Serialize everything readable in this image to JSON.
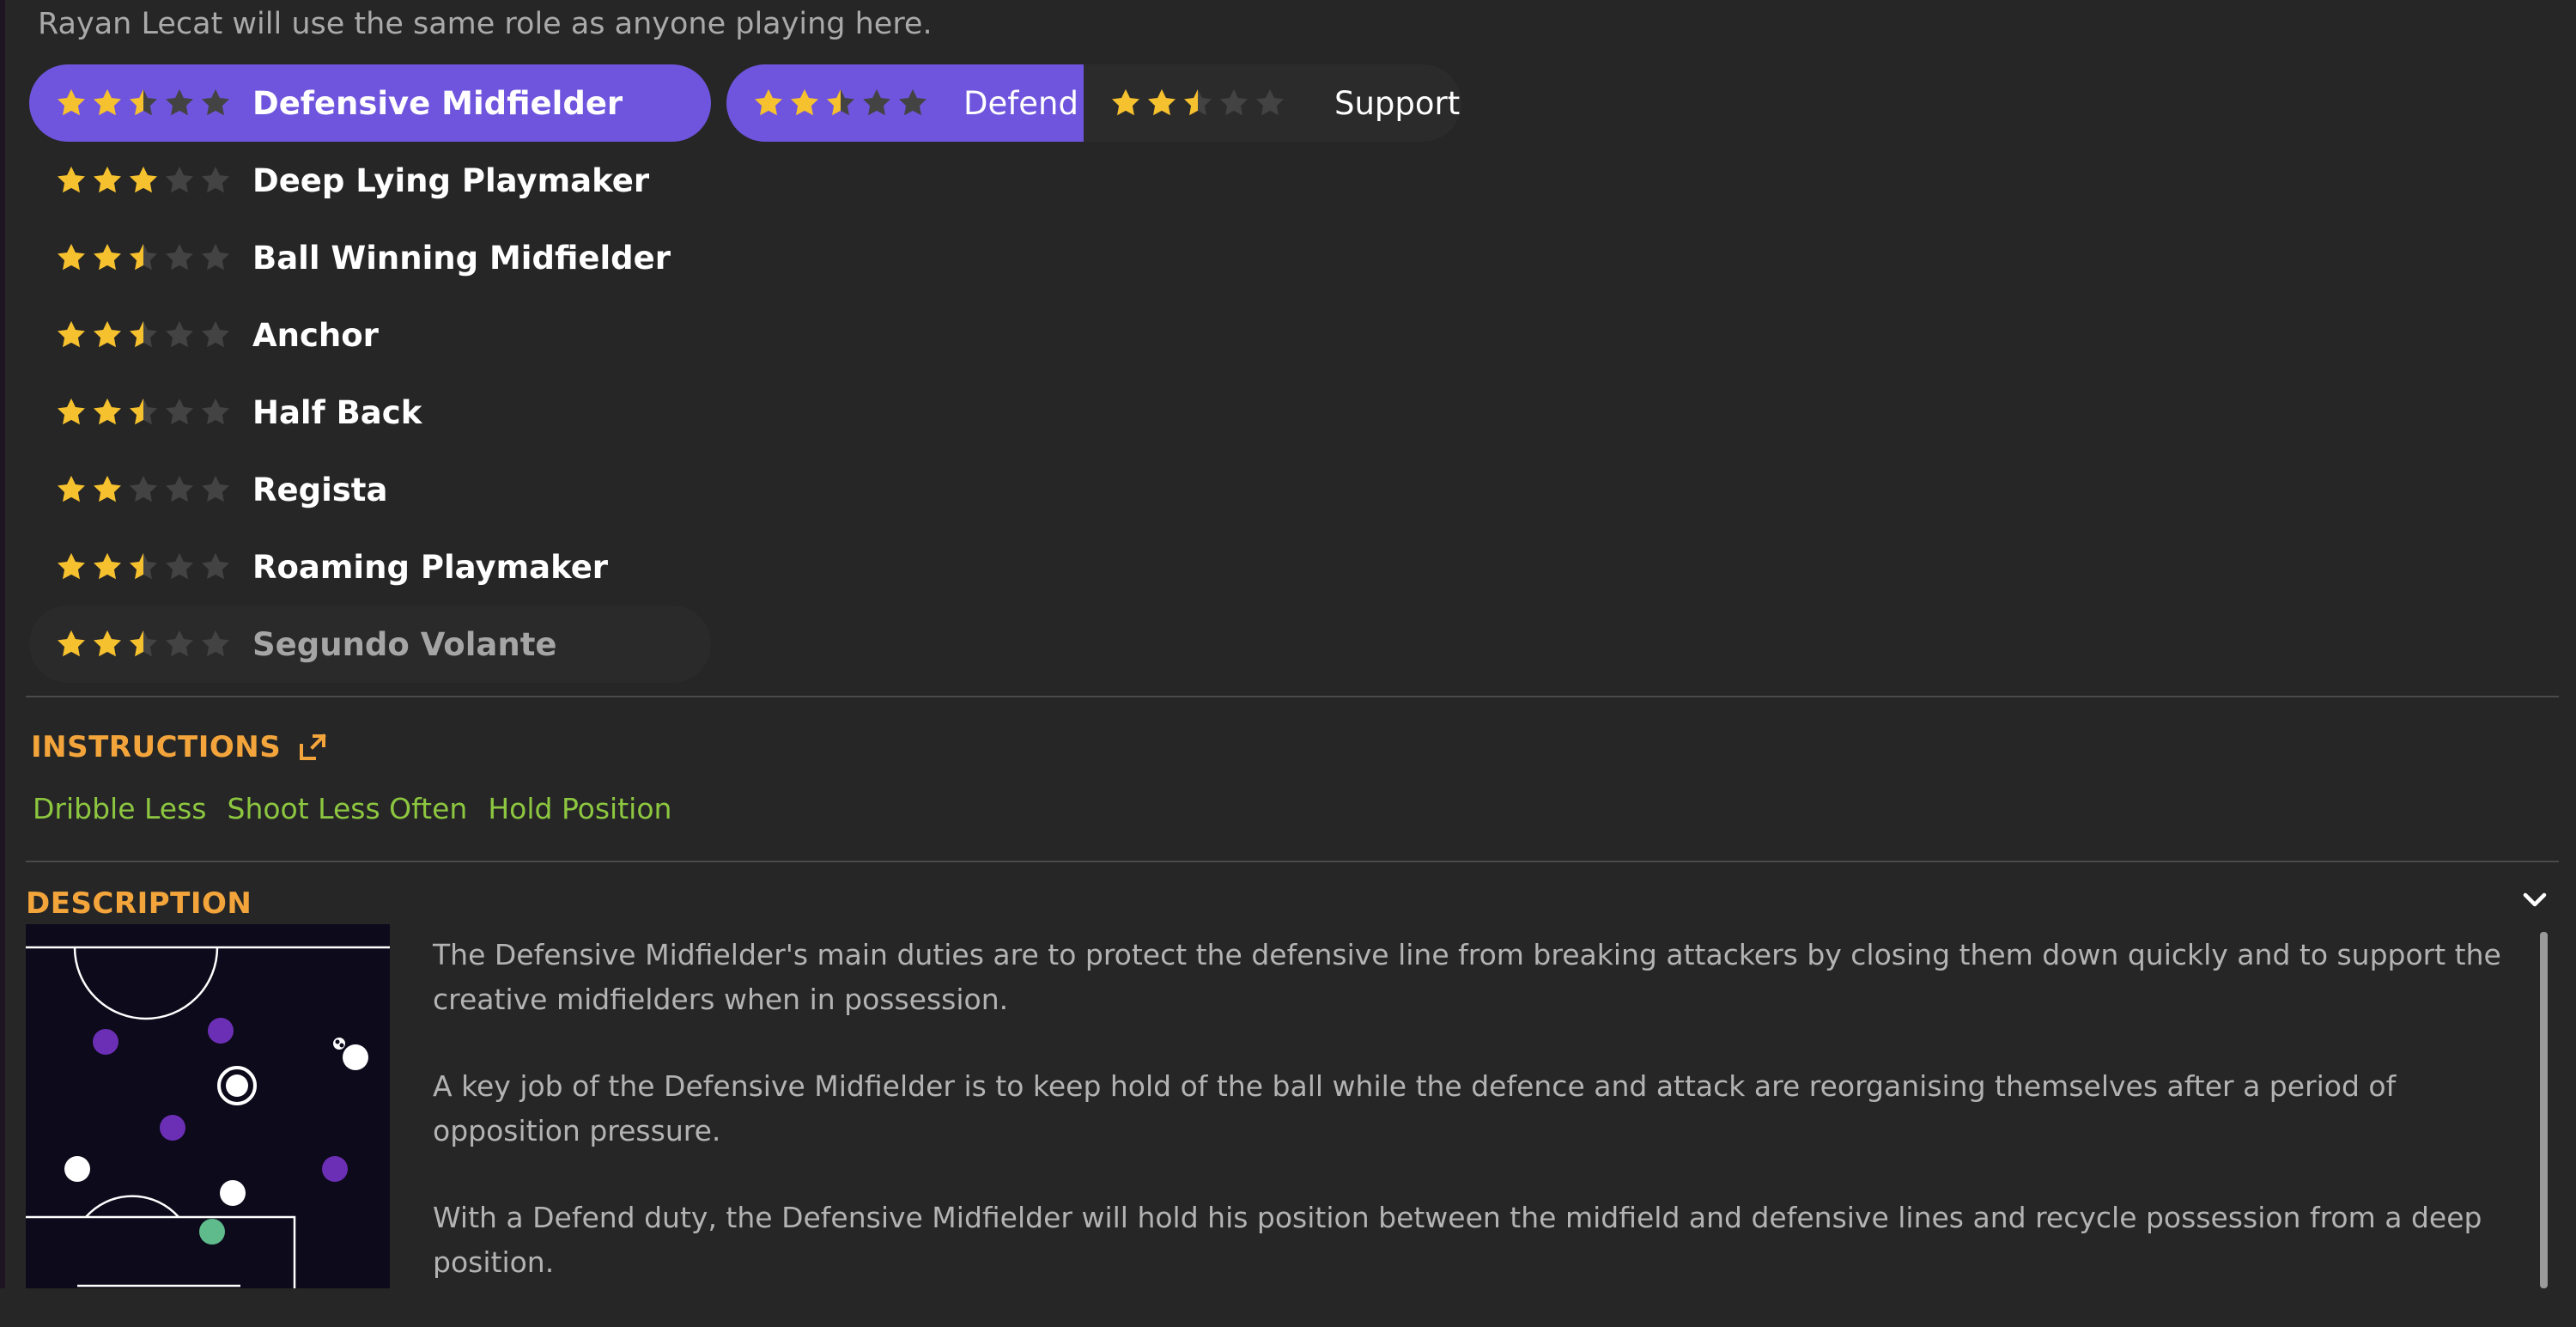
{
  "intro_text": "Rayan Lecat will use the same role as anyone playing here.",
  "colors": {
    "accent": "#6f55dd",
    "star_filled": "#f6c12e",
    "star_empty": "#434343",
    "section_title": "#f3a53b",
    "instruction": "#8dc740",
    "background": "#262626"
  },
  "roles": [
    {
      "name": "Defensive Midfielder",
      "stars": 2.5,
      "selected": true
    },
    {
      "name": "Deep Lying Playmaker",
      "stars": 3
    },
    {
      "name": "Ball Winning Midfielder",
      "stars": 2.5
    },
    {
      "name": "Anchor",
      "stars": 2.5
    },
    {
      "name": "Half Back",
      "stars": 2.5
    },
    {
      "name": "Regista",
      "stars": 2
    },
    {
      "name": "Roaming Playmaker",
      "stars": 2.5
    },
    {
      "name": "Segundo Volante",
      "stars": 2.5,
      "dimmed": true
    }
  ],
  "duties": [
    {
      "label": "Defend",
      "stars": 2.5,
      "selected": true
    },
    {
      "label": "Support",
      "stars": 2.5
    }
  ],
  "instructions": {
    "title": "INSTRUCTIONS",
    "icon": "expand-icon",
    "items": [
      "Dribble Less",
      "Shoot Less Often",
      "Hold Position"
    ]
  },
  "description": {
    "title": "DESCRIPTION",
    "icon": "chevron-down-icon",
    "paragraphs": [
      "The Defensive Midfielder's main duties are to protect the defensive line from breaking attackers by closing them down quickly and to support the creative midfielders when in possession.",
      "A key job of the Defensive Midfielder is to keep hold of the ball while the defence and attack are reorganising themselves after a period of opposition pressure.",
      "With a Defend duty, the Defensive Midfielder will hold his position between the midfield and defensive lines and recycle possession from a deep position."
    ]
  }
}
